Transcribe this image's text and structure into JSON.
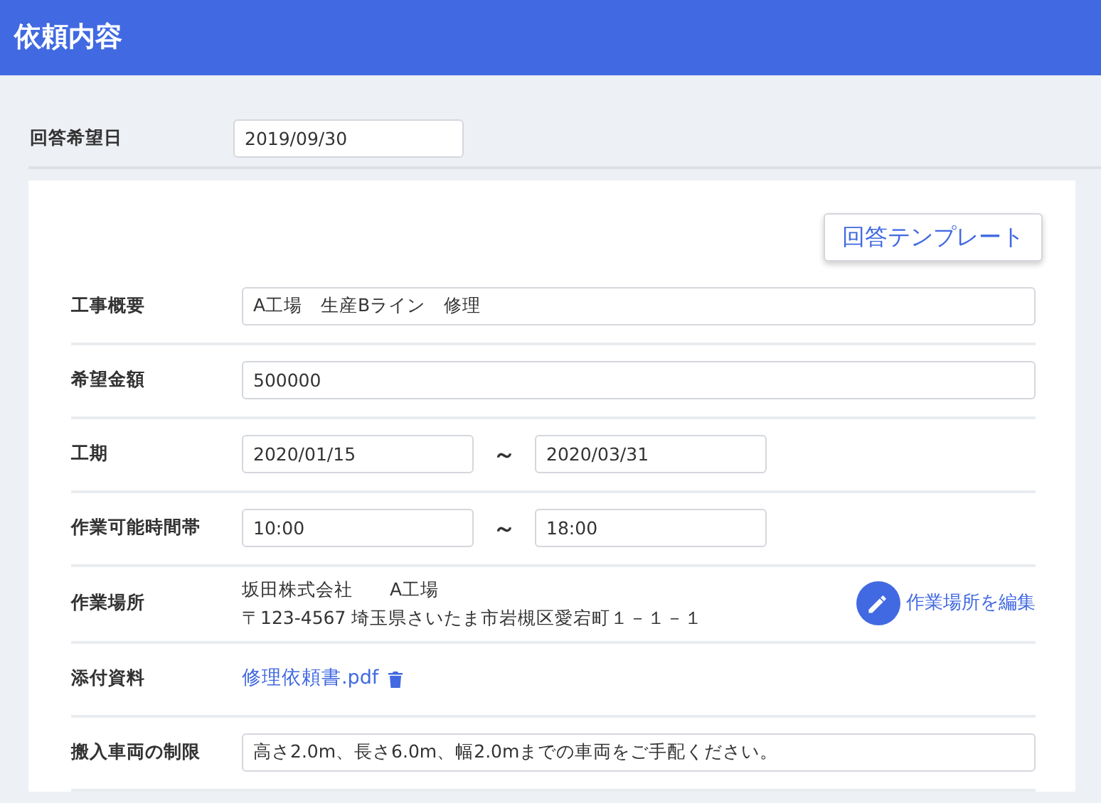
{
  "header": {
    "title": "依頼内容"
  },
  "answer_date": {
    "label": "回答希望日",
    "value": "2019/09/30"
  },
  "template_button": "回答テンプレート",
  "rows": [
    {
      "kind": "text",
      "label": "工事概要",
      "value": "A工場　生産Bライン　修理"
    },
    {
      "kind": "text",
      "label": "希望金額",
      "value": "500000"
    },
    {
      "kind": "range",
      "label": "工期",
      "from": "2020/01/15",
      "separator": "～",
      "to": "2020/03/31"
    },
    {
      "kind": "range",
      "label": "作業可能時間帯",
      "from": "10:00",
      "separator": "～",
      "to": "18:00"
    },
    {
      "kind": "address",
      "label": "作業場所",
      "lines": [
        "坂田株式会社　　A工場",
        "〒123-4567 埼玉県さいたま市岩槻区愛宕町１－１－１"
      ],
      "action": "作業場所を編集"
    },
    {
      "kind": "file",
      "label": "添付資料",
      "file": "修理依頼書.pdf"
    },
    {
      "kind": "text",
      "label": "搬入車両の制限",
      "value": "高さ2.0m、長さ6.0m、幅2.0mまでの車両をご手配ください。"
    }
  ]
}
